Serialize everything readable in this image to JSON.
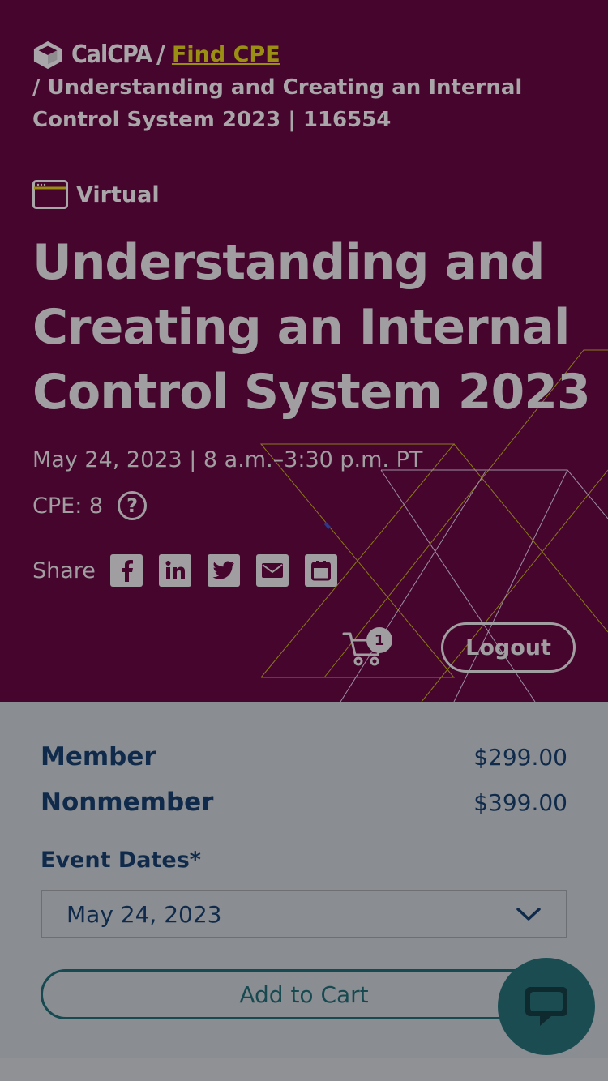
{
  "breadcrumb": {
    "brand": "CalCPA",
    "separator": "/",
    "link_label": "Find CPE",
    "current": "/ Understanding and Creating an Internal Control System 2023 | 116554"
  },
  "event": {
    "format": "Virtual",
    "title": "Understanding and Creating an Internal Control System 2023",
    "when": "May 24, 2023 | 8 a.m.–3:30 p.m. PT",
    "cpe": "CPE: 8",
    "help_glyph": "?"
  },
  "share": {
    "label": "Share",
    "icons": [
      "facebook-icon",
      "linkedin-icon",
      "twitter-icon",
      "email-icon",
      "calendar-icon"
    ]
  },
  "header_actions": {
    "cart_count": "1",
    "logout_label": "Logout"
  },
  "pricing": {
    "member_label": "Member",
    "member_price": "$299.00",
    "nonmember_label": "Nonmember",
    "nonmember_price": "$399.00"
  },
  "form": {
    "dates_label": "Event Dates*",
    "selected_date": "May 24, 2023",
    "add_to_cart_label": "Add to Cart"
  },
  "colors": {
    "hero_bg": "#45052d",
    "link": "#9a8f12",
    "panel_bg": "#8a8d92",
    "primary_text": "#0f2a4a",
    "teal": "#1a4c52"
  }
}
